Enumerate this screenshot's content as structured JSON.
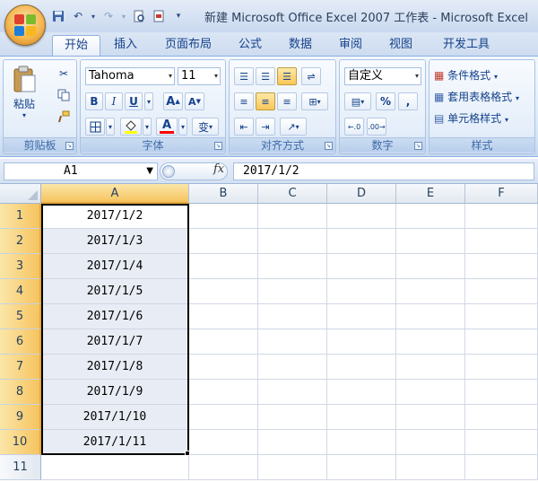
{
  "window": {
    "title": "新建 Microsoft Office Excel 2007 工作表 - Microsoft Excel"
  },
  "tabs": [
    "开始",
    "插入",
    "页面布局",
    "公式",
    "数据",
    "审阅",
    "视图",
    "开发工具"
  ],
  "active_tab": "开始",
  "ribbon": {
    "clipboard": {
      "label": "剪贴板",
      "paste_label": "粘贴"
    },
    "font": {
      "label": "字体",
      "font_name": "Tahoma",
      "font_size": "11",
      "bold": "B",
      "italic": "I",
      "underline": "U",
      "grow": "A",
      "shrink": "A",
      "font_color_letter": "A",
      "phonetic": "变"
    },
    "alignment": {
      "label": "对齐方式"
    },
    "number": {
      "label": "数字",
      "format": "自定义",
      "percent": "%",
      "comma": ","
    },
    "styles": {
      "label": "样式",
      "conditional": "条件格式",
      "table_format": "套用表格格式",
      "cell_styles": "单元格样式"
    }
  },
  "formula_bar": {
    "name_box": "A1",
    "fx": "fx",
    "formula": "2017/1/2"
  },
  "sheet": {
    "columns": [
      "A",
      "B",
      "C",
      "D",
      "E",
      "F"
    ],
    "selected_column": "A",
    "rows": [
      {
        "num": "1",
        "a": "2017/1/2"
      },
      {
        "num": "2",
        "a": "2017/1/3"
      },
      {
        "num": "3",
        "a": "2017/1/4"
      },
      {
        "num": "4",
        "a": "2017/1/5"
      },
      {
        "num": "5",
        "a": "2017/1/6"
      },
      {
        "num": "6",
        "a": "2017/1/7"
      },
      {
        "num": "7",
        "a": "2017/1/8"
      },
      {
        "num": "8",
        "a": "2017/1/9"
      },
      {
        "num": "9",
        "a": "2017/1/10"
      },
      {
        "num": "10",
        "a": "2017/1/11"
      },
      {
        "num": "11",
        "a": ""
      }
    ]
  },
  "colors": {
    "selection_header": "#f6c45f",
    "ribbon_text": "#15428b",
    "selected_range": "#e8ecf4"
  }
}
